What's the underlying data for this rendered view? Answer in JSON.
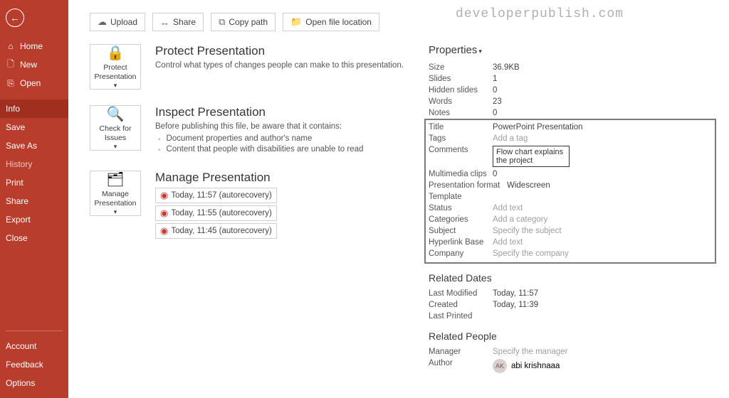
{
  "watermark": "developerpublish.com",
  "sidebar": {
    "top": [
      {
        "icon": "⌂",
        "label": "Home"
      },
      {
        "icon": "🗋",
        "label": "New"
      },
      {
        "icon": "⎘",
        "label": "Open"
      }
    ],
    "mid": [
      {
        "label": "Info",
        "selected": true
      },
      {
        "label": "Save"
      },
      {
        "label": "Save As"
      },
      {
        "label": "History",
        "dim": true
      },
      {
        "label": "Print"
      },
      {
        "label": "Share"
      },
      {
        "label": "Export"
      },
      {
        "label": "Close"
      }
    ],
    "footer": [
      "Account",
      "Feedback",
      "Options"
    ]
  },
  "toolbar": {
    "upload": "Upload",
    "share": "Share",
    "copy_path": "Copy path",
    "open_loc": "Open file location"
  },
  "sections": {
    "protect": {
      "tile": "Protect Presentation",
      "title": "Protect Presentation",
      "desc": "Control what types of changes people can make to this presentation."
    },
    "inspect": {
      "tile": "Check for Issues",
      "title": "Inspect Presentation",
      "desc": "Before publishing this file, be aware that it contains:",
      "b1": "Document properties and author's name",
      "b2": "Content that people with disabilities are unable to read"
    },
    "manage": {
      "tile": "Manage Presentation",
      "title": "Manage Presentation",
      "r1": "Today, 11:57 (autorecovery)",
      "r2": "Today, 11:55 (autorecovery)",
      "r3": "Today, 11:45 (autorecovery)"
    }
  },
  "props": {
    "heading": "Properties",
    "size": {
      "k": "Size",
      "v": "36.9KB"
    },
    "slides": {
      "k": "Slides",
      "v": "1"
    },
    "hidden": {
      "k": "Hidden slides",
      "v": "0"
    },
    "words": {
      "k": "Words",
      "v": "23"
    },
    "notes": {
      "k": "Notes",
      "v": "0"
    },
    "title": {
      "k": "Title",
      "v": "PowerPoint Presentation"
    },
    "tags": {
      "k": "Tags",
      "ph": "Add a tag"
    },
    "comments": {
      "k": "Comments",
      "v": "Flow chart explains the project"
    },
    "mm": {
      "k": "Multimedia clips",
      "v": "0"
    },
    "format": {
      "k": "Presentation format",
      "v": "Widescreen"
    },
    "template": {
      "k": "Template",
      "v": ""
    },
    "status": {
      "k": "Status",
      "ph": "Add text"
    },
    "categories": {
      "k": "Categories",
      "ph": "Add a category"
    },
    "subject": {
      "k": "Subject",
      "ph": "Specify the subject"
    },
    "hyperlink": {
      "k": "Hyperlink Base",
      "ph": "Add text"
    },
    "company": {
      "k": "Company",
      "ph": "Specify the company"
    }
  },
  "dates": {
    "heading": "Related Dates",
    "modified": {
      "k": "Last Modified",
      "v": "Today, 11:57"
    },
    "created": {
      "k": "Created",
      "v": "Today, 11:39"
    },
    "printed": {
      "k": "Last Printed",
      "v": ""
    }
  },
  "people": {
    "heading": "Related People",
    "manager": {
      "k": "Manager",
      "ph": "Specify the manager"
    },
    "author": {
      "k": "Author",
      "initials": "AK",
      "name": "abi krishnaaa"
    }
  }
}
